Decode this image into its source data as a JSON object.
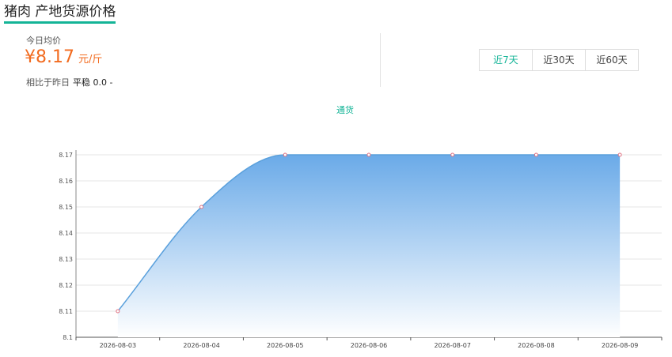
{
  "page": {
    "title": "猪肉 产地货源价格",
    "summary": {
      "label": "今日均价",
      "price": "¥8.17",
      "unit": "元/斤",
      "compare_label": "相比于昨日",
      "compare_value": "平稳 0.0 -"
    },
    "tabs": [
      {
        "label": "近7天",
        "active": true
      },
      {
        "label": "近30天",
        "active": false
      },
      {
        "label": "近60天",
        "active": false
      }
    ]
  },
  "colors": {
    "accent": "#14b497",
    "price": "#f26b1f",
    "line": "#5aa0dc",
    "area_top": "#6aaae8",
    "point": "#e07080"
  },
  "chart_data": {
    "type": "area",
    "legend": [
      "通货"
    ],
    "legend_position": "top-center",
    "grid": true,
    "x": [
      "2026-08-03",
      "2026-08-04",
      "2026-08-05",
      "2026-08-06",
      "2026-08-07",
      "2026-08-08",
      "2026-08-09"
    ],
    "series": [
      {
        "name": "通货",
        "values": [
          8.11,
          8.15,
          8.17,
          8.17,
          8.17,
          8.17,
          8.17
        ]
      }
    ],
    "ylim": [
      8.1,
      8.17
    ],
    "yticks": [
      "8.1",
      "8.11",
      "8.12",
      "8.13",
      "8.14",
      "8.15",
      "8.16",
      "8.17"
    ],
    "smooth": true
  }
}
